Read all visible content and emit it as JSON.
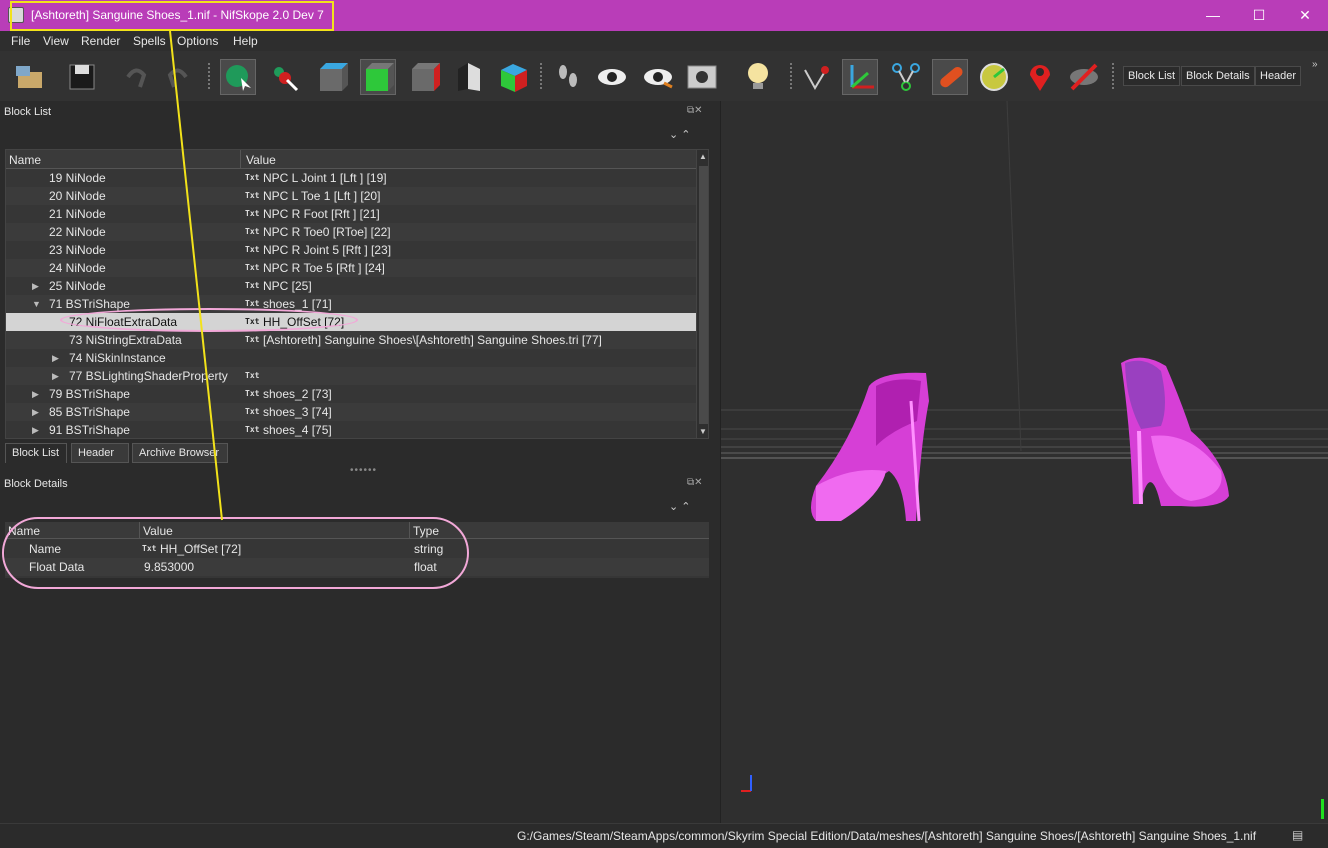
{
  "window": {
    "title": "[Ashtoreth] Sanguine Shoes_1.nif - NifSkope 2.0 Dev 7",
    "minimize_glyph": "—",
    "maximize_glyph": "☐",
    "close_glyph": "✕"
  },
  "menu": {
    "items": [
      "File",
      "View",
      "Render",
      "Spells",
      "Options",
      "Help"
    ]
  },
  "toolbar": {
    "icons": [
      "load-icon",
      "save-icon",
      "undo-icon",
      "redo-icon",
      "select-mode-icon",
      "pick-icon",
      "view-top-icon",
      "view-front-icon",
      "view-side-icon",
      "view-user-icon",
      "view-walk-icon",
      "footprints-icon",
      "eye-icon",
      "eye-alt-icon",
      "screenshot-icon",
      "light-bulb-icon",
      "vertices-icon",
      "axes-icon",
      "nodes-icon",
      "constraints-icon",
      "collision-icon",
      "marker-icon",
      "hide-icon"
    ],
    "text_buttons": [
      "Block List",
      "Block Details",
      "Header"
    ],
    "overflow": "»"
  },
  "block_list": {
    "title": "Block List",
    "columns": [
      "Name",
      "Value"
    ],
    "txt_tag": "Txt",
    "rows": [
      {
        "name": "19 NiNode",
        "value": "NPC L Joint 1 [Lft ] [19]",
        "has_txt": true,
        "arrow": ""
      },
      {
        "name": "20 NiNode",
        "value": "NPC L Toe 1 [Lft ] [20]",
        "has_txt": true,
        "arrow": ""
      },
      {
        "name": "21 NiNode",
        "value": "NPC R Foot [Rft ] [21]",
        "has_txt": true,
        "arrow": ""
      },
      {
        "name": "22 NiNode",
        "value": "NPC R Toe0 [RToe] [22]",
        "has_txt": true,
        "arrow": ""
      },
      {
        "name": "23 NiNode",
        "value": "NPC R Joint 5 [Rft ] [23]",
        "has_txt": true,
        "arrow": ""
      },
      {
        "name": "24 NiNode",
        "value": "NPC R Toe 5 [Rft ] [24]",
        "has_txt": true,
        "arrow": ""
      },
      {
        "name": "25 NiNode",
        "value": "NPC [25]",
        "has_txt": true,
        "arrow": "▶"
      },
      {
        "name": "71 BSTriShape",
        "value": "shoes_1 [71]",
        "has_txt": true,
        "arrow": "▼"
      },
      {
        "name": "72 NiFloatExtraData",
        "value": "HH_OffSet [72]",
        "has_txt": true,
        "arrow": ""
      },
      {
        "name": "73 NiStringExtraData",
        "value": "[Ashtoreth] Sanguine Shoes\\[Ashtoreth] Sanguine Shoes.tri [77]",
        "has_txt": true,
        "arrow": ""
      },
      {
        "name": "74 NiSkinInstance",
        "value": "",
        "has_txt": false,
        "arrow": "▶"
      },
      {
        "name": "77 BSLightingShaderProperty",
        "value": "",
        "has_txt": true,
        "arrow": "▶"
      },
      {
        "name": "79 BSTriShape",
        "value": "shoes_2 [73]",
        "has_txt": true,
        "arrow": "▶"
      },
      {
        "name": "85 BSTriShape",
        "value": "shoes_3 [74]",
        "has_txt": true,
        "arrow": "▶"
      },
      {
        "name": "91 BSTriShape",
        "value": "shoes_4 [75]",
        "has_txt": true,
        "arrow": "▶"
      }
    ],
    "selected_index": 8
  },
  "tabs": [
    "Block List",
    "Header",
    "Archive Browser"
  ],
  "block_details": {
    "title": "Block Details",
    "columns": [
      "Name",
      "Value",
      "Type"
    ],
    "rows": [
      {
        "name": "Name",
        "value": "HH_OffSet [72]",
        "type": "string",
        "has_txt": true
      },
      {
        "name": "Float Data",
        "value": "9.853000",
        "type": "float",
        "has_txt": false
      }
    ]
  },
  "status": {
    "path": "G:/Games/Steam/SteamApps/common/Skyrim Special Edition/Data/meshes/[Ashtoreth] Sanguine Shoes/[Ashtoreth] Sanguine Shoes_1.nif"
  },
  "colors": {
    "titlebar": "#b93db8",
    "annotation_yellow": "#f2e21a",
    "annotation_pink": "#f2a8d8",
    "shoe_magenta": "#e040e0"
  }
}
